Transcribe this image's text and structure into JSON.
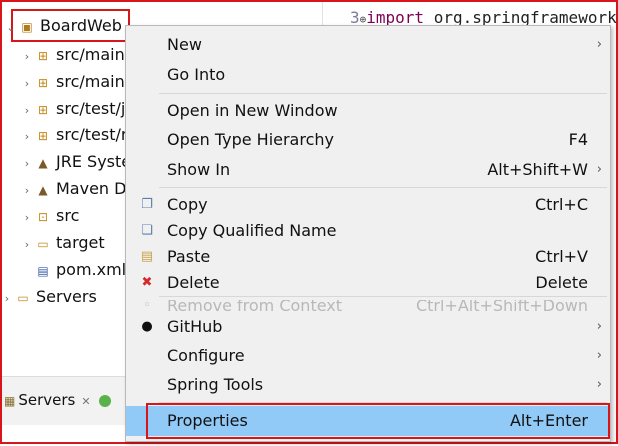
{
  "tree": {
    "project": "BoardWeb",
    "items": [
      {
        "label": "src/main",
        "icon": "package-folder-icon"
      },
      {
        "label": "src/main",
        "icon": "package-folder-icon"
      },
      {
        "label": "src/test/j",
        "icon": "package-folder-icon"
      },
      {
        "label": "src/test/r",
        "icon": "package-folder-icon"
      },
      {
        "label": "JRE Syste",
        "icon": "library-icon"
      },
      {
        "label": "Maven D",
        "icon": "library-icon"
      },
      {
        "label": "src",
        "icon": "source-folder-icon"
      },
      {
        "label": "target",
        "icon": "folder-icon"
      },
      {
        "label": "pom.xml",
        "icon": "xml-file-icon"
      }
    ],
    "servers": "Servers"
  },
  "editor": {
    "line_number": "3",
    "keyword": "import",
    "text": " org.springframework"
  },
  "bottom_panel": {
    "tab_label": "Servers"
  },
  "menu": {
    "items": [
      {
        "label": "New",
        "accel": "",
        "submenu": true
      },
      {
        "label": "Go Into",
        "accel": "",
        "submenu": false
      },
      {
        "label": "Open in New Window",
        "accel": "",
        "submenu": false
      },
      {
        "label": "Open Type Hierarchy",
        "accel": "F4",
        "submenu": false
      },
      {
        "label": "Show In",
        "accel": "Alt+Shift+W",
        "submenu": true
      },
      {
        "label": "Copy",
        "accel": "Ctrl+C",
        "submenu": false,
        "icon": "copy-icon"
      },
      {
        "label": "Copy Qualified Name",
        "accel": "",
        "submenu": false,
        "icon": "copy-qualified-icon"
      },
      {
        "label": "Paste",
        "accel": "Ctrl+V",
        "submenu": false,
        "icon": "paste-icon"
      },
      {
        "label": "Delete",
        "accel": "Delete",
        "submenu": false,
        "icon": "delete-icon"
      },
      {
        "label": "Remove from Context",
        "accel": "Ctrl+Alt+Shift+Down",
        "submenu": false,
        "faded": true
      },
      {
        "label": "GitHub",
        "accel": "",
        "submenu": true,
        "icon": "github-icon"
      },
      {
        "label": "Configure",
        "accel": "",
        "submenu": true
      },
      {
        "label": "Spring Tools",
        "accel": "",
        "submenu": true
      },
      {
        "label": "Properties",
        "accel": "Alt+Enter",
        "submenu": false,
        "highlighted": true
      }
    ]
  },
  "colors": {
    "highlight": "#91c9f7",
    "annotation_red": "#d6161b",
    "menu_bg": "#f0f0f0"
  }
}
